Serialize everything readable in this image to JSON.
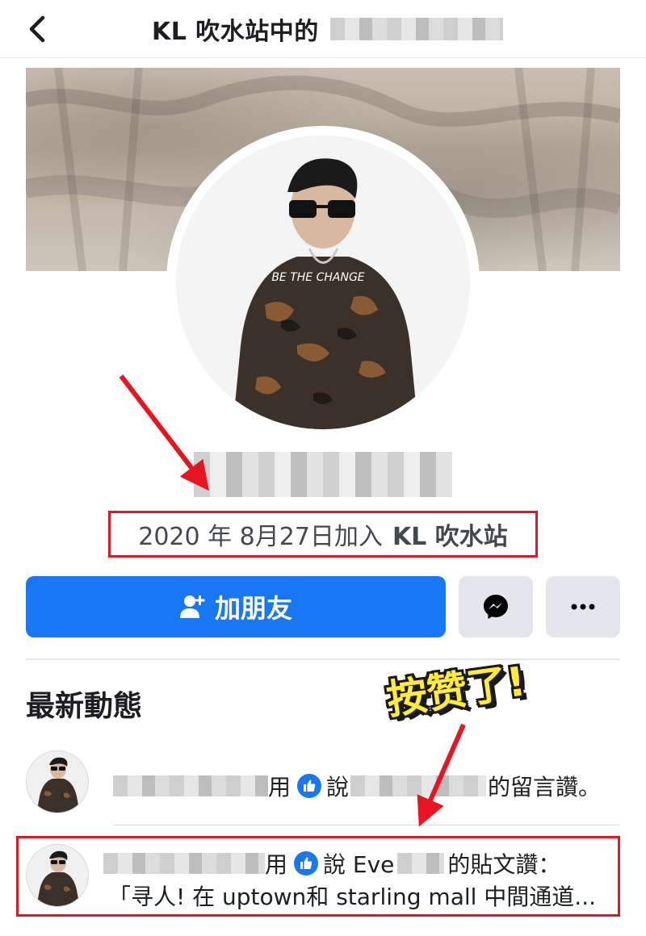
{
  "header": {
    "title": "KL 吹水站中的"
  },
  "profile": {
    "joined_text": "2020 年 8月27日加入",
    "group_name": "KL 吹水站"
  },
  "actions": {
    "add_friend_label": "加朋友",
    "messenger_icon": "messenger-icon",
    "more_icon": "more-horizontal-icon"
  },
  "section": {
    "title": "最新動態"
  },
  "sticker": {
    "text": "按赞了!"
  },
  "feed": [
    {
      "verb": "用",
      "says": "說",
      "suffix": "的留言讚。"
    },
    {
      "verb": "用",
      "says": "說 Eve",
      "suffix": "的貼文讚：",
      "preview": "「寻人! 在 uptown和 starling mall 中間通道..."
    }
  ],
  "colors": {
    "brand_blue": "#1877f2",
    "annotation_red": "#e8141f",
    "sticker_yellow": "#ffeb3b"
  }
}
